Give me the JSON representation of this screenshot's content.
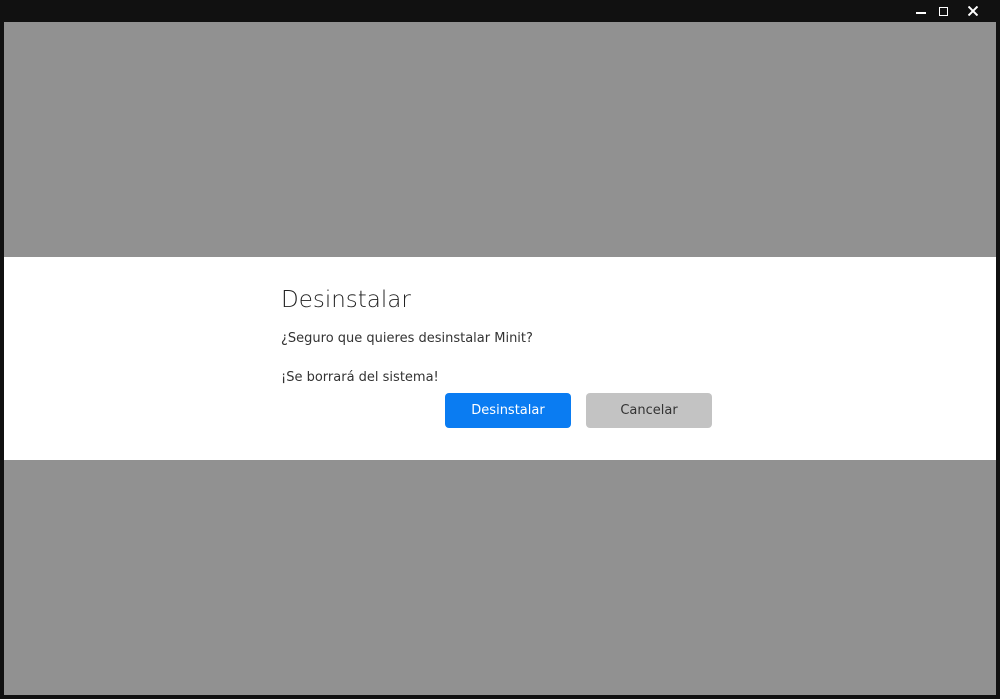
{
  "window": {
    "controls": {
      "minimize_icon": "minimize-icon",
      "maximize_icon": "maximize-icon",
      "close_icon": "close-icon"
    },
    "colors": {
      "titlebar": "#111111",
      "overlay": "#919191",
      "dialog_bg": "#ffffff"
    }
  },
  "dialog": {
    "title": "Desinstalar",
    "question": "¿Seguro que quieres desinstalar Minit?",
    "warning": "¡Se borrará del sistema!",
    "buttons": {
      "uninstall_label": "Desinstalar",
      "cancel_label": "Cancelar"
    },
    "colors": {
      "primary": "#0a7cf2",
      "secondary": "#c3c3c3"
    }
  }
}
